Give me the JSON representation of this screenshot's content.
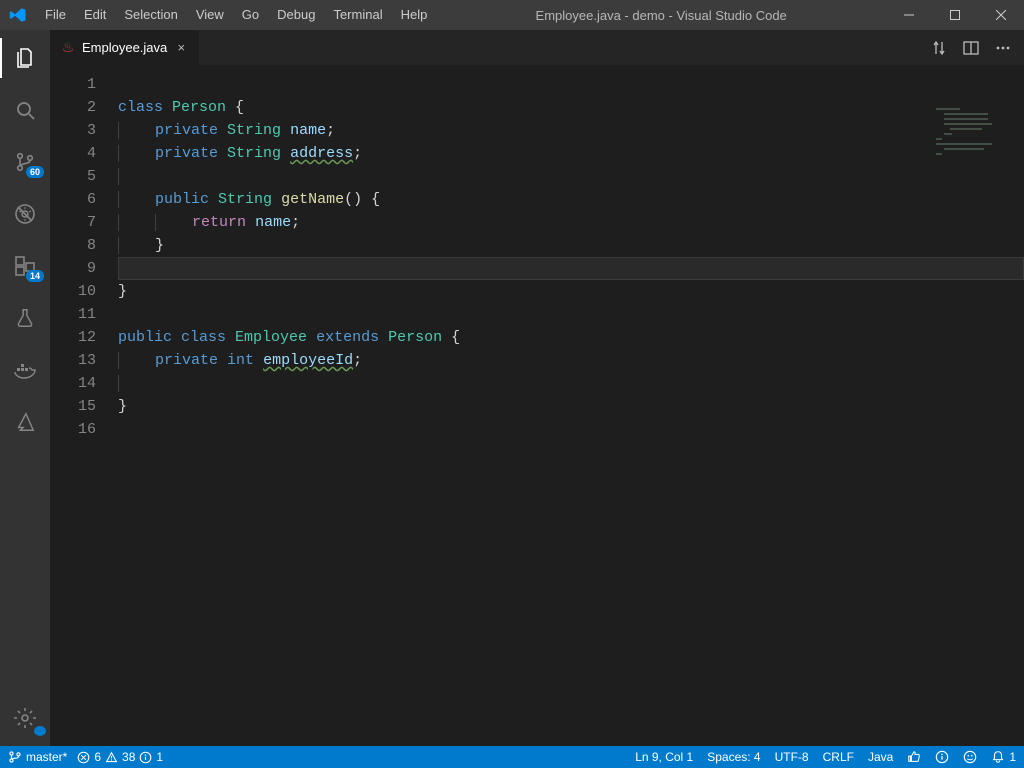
{
  "menus": [
    "File",
    "Edit",
    "Selection",
    "View",
    "Go",
    "Debug",
    "Terminal",
    "Help"
  ],
  "window_title": "Employee.java - demo - Visual Studio Code",
  "tab": {
    "label": "Employee.java"
  },
  "activity_badges": {
    "scm": "60",
    "ext": "14"
  },
  "code": {
    "lines": [
      {
        "n": "1",
        "segs": []
      },
      {
        "n": "2",
        "segs": [
          [
            "kw",
            "class "
          ],
          [
            "type",
            "Person"
          ],
          [
            "text",
            " "
          ],
          [
            "br",
            "{"
          ]
        ]
      },
      {
        "n": "3",
        "indent": 1,
        "segs": [
          [
            "kw",
            "private "
          ],
          [
            "type",
            "String"
          ],
          [
            "text",
            " "
          ],
          [
            "id",
            "name"
          ],
          [
            "semi",
            ";"
          ]
        ]
      },
      {
        "n": "4",
        "indent": 1,
        "segs": [
          [
            "kw",
            "private "
          ],
          [
            "type",
            "String"
          ],
          [
            "text",
            " "
          ],
          [
            "id squiggle",
            "address"
          ],
          [
            "semi",
            ";"
          ]
        ]
      },
      {
        "n": "5",
        "indent": 1,
        "segs": []
      },
      {
        "n": "6",
        "indent": 1,
        "segs": [
          [
            "kw",
            "public "
          ],
          [
            "type",
            "String"
          ],
          [
            "text",
            " "
          ],
          [
            "fn",
            "getName"
          ],
          [
            "br",
            "()"
          ],
          [
            "text",
            " "
          ],
          [
            "br",
            "{"
          ]
        ]
      },
      {
        "n": "7",
        "indent": 2,
        "segs": [
          [
            "flow",
            "return"
          ],
          [
            "text",
            " "
          ],
          [
            "id",
            "name"
          ],
          [
            "semi",
            ";"
          ]
        ]
      },
      {
        "n": "8",
        "indent": 1,
        "segs": [
          [
            "br",
            "}"
          ]
        ]
      },
      {
        "n": "9",
        "indent": 1,
        "hl": true,
        "segs": []
      },
      {
        "n": "10",
        "segs": [
          [
            "br",
            "}"
          ]
        ]
      },
      {
        "n": "11",
        "segs": []
      },
      {
        "n": "12",
        "segs": [
          [
            "kw",
            "public class "
          ],
          [
            "type",
            "Employee"
          ],
          [
            "text",
            " "
          ],
          [
            "kw",
            "extends"
          ],
          [
            "text",
            " "
          ],
          [
            "type",
            "Person"
          ],
          [
            "text",
            " "
          ],
          [
            "br",
            "{"
          ]
        ]
      },
      {
        "n": "13",
        "indent": 1,
        "segs": [
          [
            "kw",
            "private "
          ],
          [
            "kw",
            "int"
          ],
          [
            "text",
            " "
          ],
          [
            "id squiggle",
            "employeeId"
          ],
          [
            "semi",
            ";"
          ]
        ]
      },
      {
        "n": "14",
        "indent": 1,
        "segs": []
      },
      {
        "n": "15",
        "segs": [
          [
            "br",
            "}"
          ]
        ]
      },
      {
        "n": "16",
        "segs": []
      }
    ]
  },
  "status": {
    "branch": "master*",
    "errors": "6",
    "warnings": "38",
    "info": "1",
    "cursor": "Ln 9, Col 1",
    "spaces": "Spaces: 4",
    "encoding": "UTF-8",
    "eol": "CRLF",
    "lang": "Java",
    "bell": "1"
  }
}
